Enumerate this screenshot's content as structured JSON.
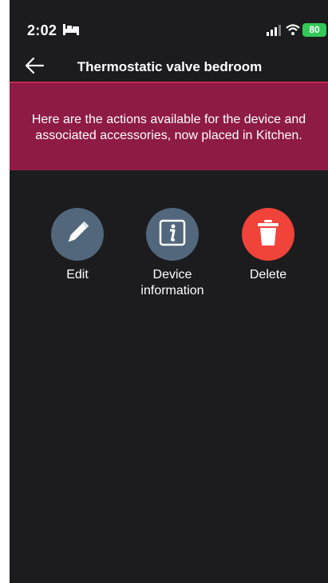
{
  "status_bar": {
    "time": "2:02",
    "battery_level": "80",
    "icons": [
      "bed-icon",
      "signal-icon",
      "wifi-icon",
      "battery-icon"
    ]
  },
  "nav": {
    "back_icon": "back-arrow-icon",
    "title": "Thermostatic valve bedroom"
  },
  "banner": {
    "text": "Here are the actions available for the device and associated accessories, now placed in Kitchen.",
    "color": "#8e1b44"
  },
  "actions": [
    {
      "label": "Edit",
      "icon": "pencil-icon",
      "color": "#52677b"
    },
    {
      "label": "Device information",
      "icon": "info-icon",
      "color": "#52677b"
    },
    {
      "label": "Delete",
      "icon": "trash-icon",
      "color": "#f0433a"
    }
  ]
}
